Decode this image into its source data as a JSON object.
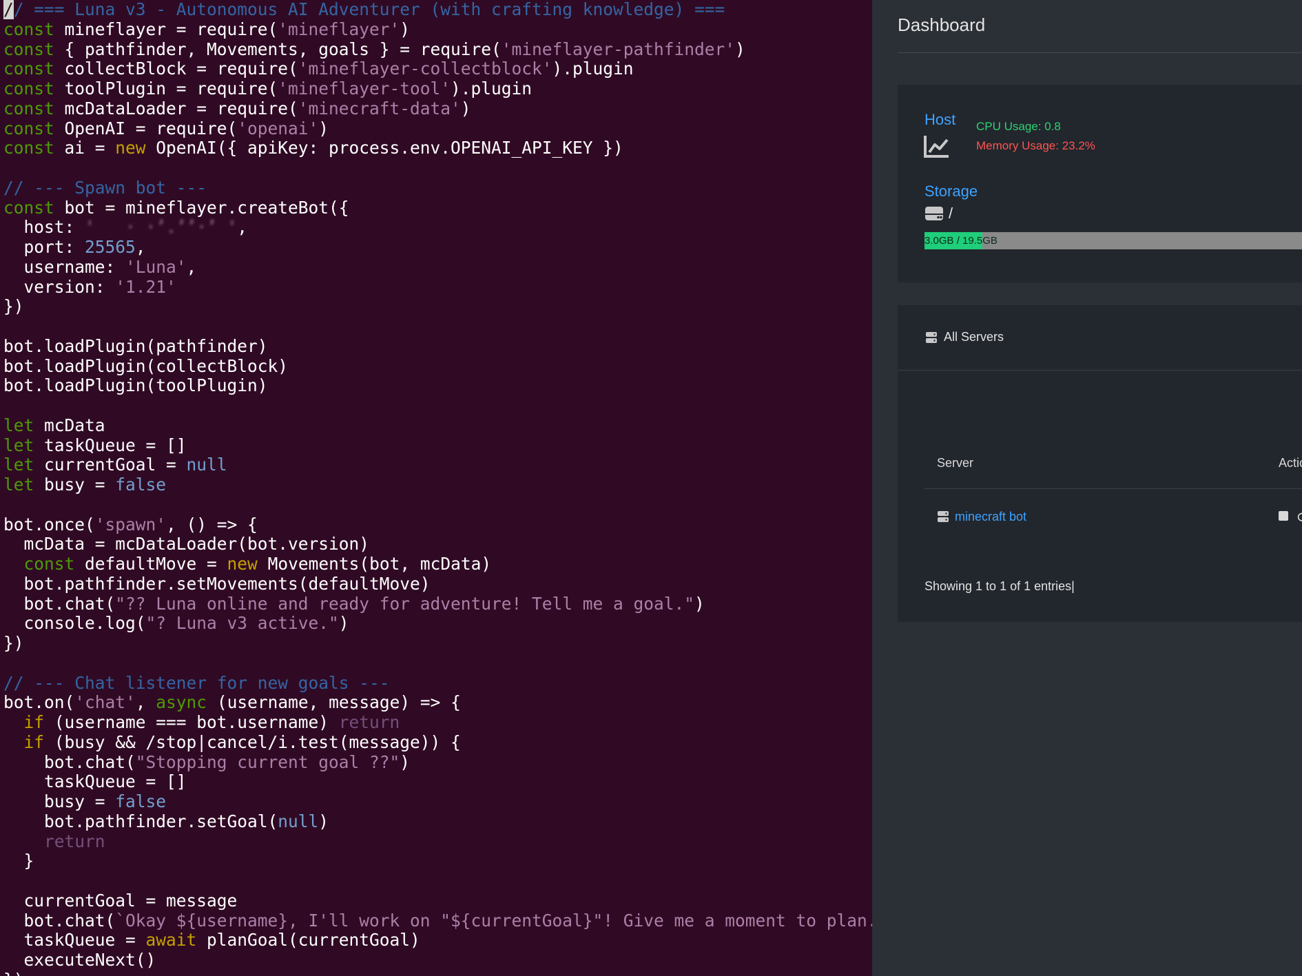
{
  "editor": {
    "lines": [
      "// === Luna v3 - Autonomous AI Adventurer (with crafting knowledge) ===",
      "const mineflayer = require('mineflayer')",
      "const { pathfinder, Movements, goals } = require('mineflayer-pathfinder')",
      "const collectBlock = require('mineflayer-collectblock').plugin",
      "const toolPlugin = require('mineflayer-tool').plugin",
      "const mcDataLoader = require('minecraft-data')",
      "const OpenAI = require('openai')",
      "const ai = new OpenAI({ apiKey: process.env.OPENAI_API_KEY })",
      "",
      "// --- Spawn bot ---",
      "const bot = mineflayer.createBot({",
      "  host: '[redacted]',",
      "  port: 25565,",
      "  username: 'Luna',",
      "  version: '1.21'",
      "})",
      "",
      "bot.loadPlugin(pathfinder)",
      "bot.loadPlugin(collectBlock)",
      "bot.loadPlugin(toolPlugin)",
      "",
      "let mcData",
      "let taskQueue = []",
      "let currentGoal = null",
      "let busy = false",
      "",
      "bot.once('spawn', () => {",
      "  mcData = mcDataLoader(bot.version)",
      "  const defaultMove = new Movements(bot, mcData)",
      "  bot.pathfinder.setMovements(defaultMove)",
      "  bot.chat(\"?? Luna online and ready for adventure! Tell me a goal.\")",
      "  console.log(\"? Luna v3 active.\")",
      "})",
      "",
      "// --- Chat listener for new goals ---",
      "bot.on('chat', async (username, message) => {",
      "  if (username === bot.username) return",
      "  if (busy && /stop|cancel/i.test(message)) {",
      "    bot.chat(\"Stopping current goal ??\")",
      "    taskQueue = []",
      "    busy = false",
      "    bot.pathfinder.setGoal(null)",
      "    return",
      "  }",
      "",
      "  currentGoal = message",
      "  bot.chat(`Okay ${username}, I'll work on \"${currentGoal}\"! Give me a moment to plan.`)",
      "  taskQueue = await planGoal(currentGoal)",
      "  executeNext()",
      "})"
    ],
    "colors": {
      "background": "#300a24",
      "keyword": "#4e9a06",
      "keyword2": "#c4a000",
      "string": "#ad7fa8",
      "number": "#729fcf",
      "comment": "#3465a4"
    }
  },
  "dashboard": {
    "title": "Dashboard",
    "host": {
      "label": "Host",
      "cpu": "CPU Usage: 0.8",
      "memory": "Memory Usage: 23.2%"
    },
    "storage": {
      "label": "Storage",
      "mount": "/",
      "bar_text": "3.0GB / 19.5GB",
      "used_fraction": 0.154
    },
    "servers_panel": {
      "title": "All Servers",
      "columns": [
        "Server",
        "Action"
      ],
      "rows": [
        {
          "name": "minecraft bot"
        }
      ],
      "footer": "Showing 1 to 1 of 1 entries|"
    },
    "colors": {
      "link": "#3ea4ff",
      "cpu": "#2ed273",
      "memory": "#ff5450",
      "bar_fill": "#1fce7a"
    }
  }
}
